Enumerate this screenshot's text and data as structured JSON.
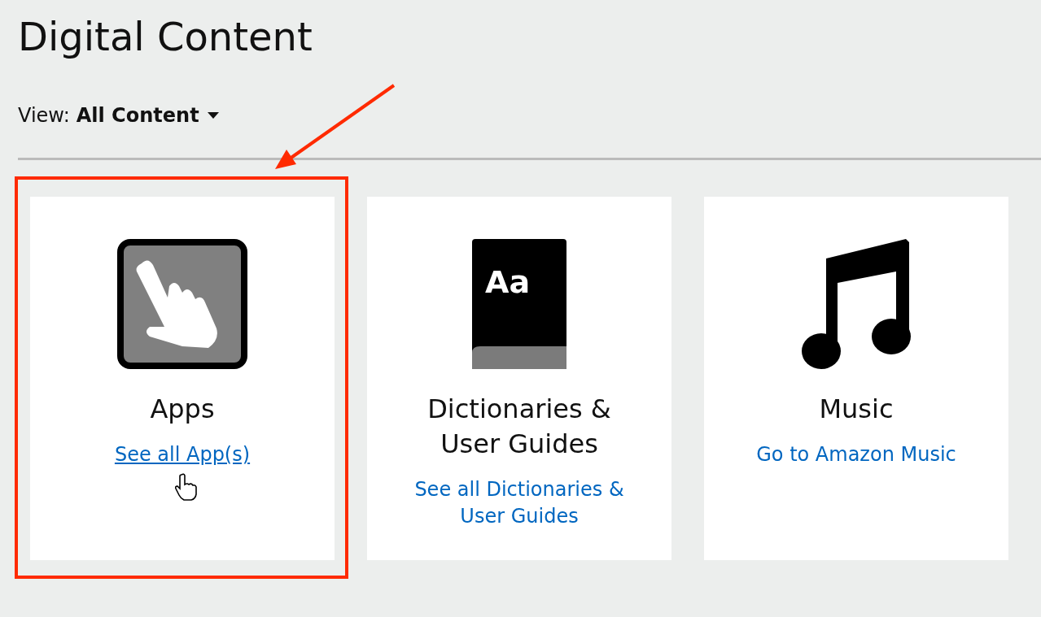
{
  "title": "Digital Content",
  "view": {
    "label": "View:",
    "value": "All Content"
  },
  "cards": [
    {
      "kind": "apps",
      "title": "Apps",
      "link": "See all App(s)",
      "hovered": true,
      "highlighted": true
    },
    {
      "kind": "dictionary",
      "icon_label": "Aa",
      "title": "Dictionaries & User Guides",
      "link": "See all Dictionaries & User Guides",
      "hovered": false,
      "highlighted": false
    },
    {
      "kind": "music",
      "title": "Music",
      "link": "Go to Amazon Music",
      "hovered": false,
      "highlighted": false
    }
  ]
}
